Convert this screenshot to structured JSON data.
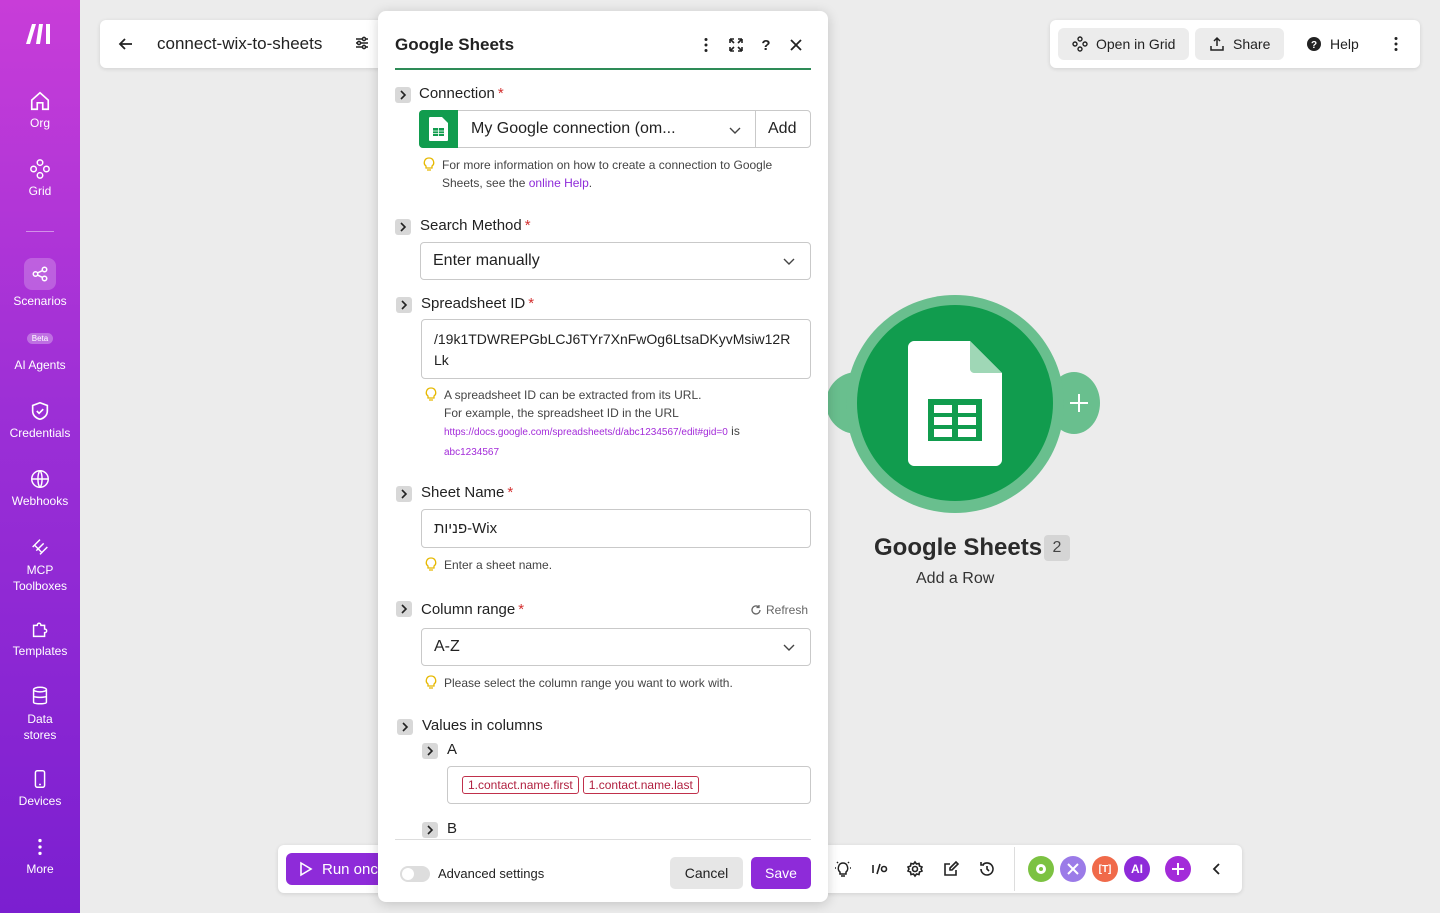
{
  "sidebar": {
    "items": [
      {
        "label": "Org",
        "icon": "home-icon"
      },
      {
        "label": "Grid",
        "icon": "grid-icon"
      },
      {
        "label": "Scenarios",
        "icon": "share-nodes-icon"
      },
      {
        "label": "AI Agents",
        "icon": "ai-agent-icon",
        "badge": "Beta"
      },
      {
        "label": "Credentials",
        "icon": "shield-check-icon"
      },
      {
        "label": "Webhooks",
        "icon": "globe-icon"
      },
      {
        "label": "MCP Toolboxes",
        "icon": "mcp-icon"
      },
      {
        "label": "Templates",
        "icon": "puzzle-icon"
      },
      {
        "label": "Data stores",
        "icon": "database-icon"
      },
      {
        "label": "Devices",
        "icon": "mobile-icon"
      },
      {
        "label": "More",
        "icon": "more-vertical-icon"
      }
    ]
  },
  "topbar": {
    "scenario_name": "connect-wix-to-sheets"
  },
  "topright": {
    "open_in_grid": "Open in Grid",
    "share": "Share",
    "help": "Help"
  },
  "canvas": {
    "module_title": "Google Sheets",
    "module_badge": "2",
    "module_subtitle": "Add a Row",
    "module_color": "#119c4e"
  },
  "bottom": {
    "run_once": "Run once"
  },
  "panel": {
    "title": "Google Sheets",
    "connection": {
      "label": "Connection",
      "value": "My Google connection (om...",
      "add_label": "Add",
      "hint_text": "For more information on how to create a connection to Google Sheets, see the ",
      "hint_link": "online Help",
      "hint_end": "."
    },
    "search_method": {
      "label": "Search Method",
      "value": "Enter manually"
    },
    "spreadsheet_id": {
      "label": "Spreadsheet ID",
      "value_line1": "/19k1TDWREPGbLCJ6TYr7XnFwOg6LtsaDKyvMsiw12R",
      "value_line2": "Lk",
      "hint_line1": "A spreadsheet ID can be extracted from its URL.",
      "hint_line2": "For example, the spreadsheet ID in the URL",
      "hint_url": "https://docs.google.com/spreadsheets/d/abc1234567/edit#gid=0",
      "hint_is": " is",
      "hint_example": "abc1234567"
    },
    "sheet_name": {
      "label": "Sheet Name",
      "value": "פניות-Wix",
      "hint": "Enter a sheet name."
    },
    "column_range": {
      "label": "Column range",
      "refresh": "Refresh",
      "value": "A-Z",
      "hint": "Please select the column range you want to work with."
    },
    "values_in_columns": {
      "label": "Values in columns",
      "col_a": "A",
      "col_a_pills": [
        "1.contact.name.first",
        "1.contact.name.last"
      ],
      "col_b": "B"
    },
    "advanced_settings": "Advanced settings",
    "cancel": "Cancel",
    "save": "Save"
  },
  "colors": {
    "accent": "#8e2bd9",
    "sheets_green": "#119c4e",
    "required": "#d32f2f"
  }
}
